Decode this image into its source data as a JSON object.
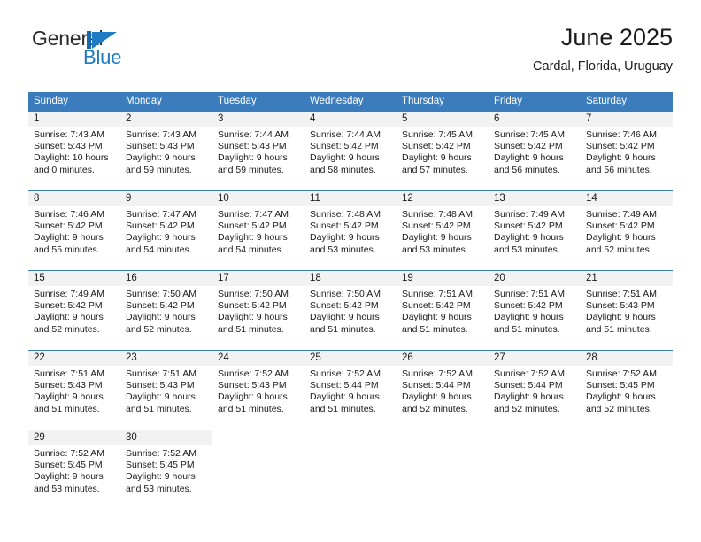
{
  "brand": {
    "name_top": "General",
    "name_bottom": "Blue",
    "mark": "blue-triangle-logo",
    "accent_color": "#1f7cc4"
  },
  "header": {
    "title": "June 2025",
    "subtitle": "Cardal, Florida, Uruguay"
  },
  "theme": {
    "header_blue": "#3b7cbd",
    "day_band_gray": "#f2f2f2",
    "text_color": "#1a1a1a"
  },
  "weekdays": [
    "Sunday",
    "Monday",
    "Tuesday",
    "Wednesday",
    "Thursday",
    "Friday",
    "Saturday"
  ],
  "weeks": [
    [
      {
        "day": "1",
        "sunrise": "Sunrise: 7:43 AM",
        "sunset": "Sunset: 5:43 PM",
        "daylight1": "Daylight: 10 hours",
        "daylight2": "and 0 minutes."
      },
      {
        "day": "2",
        "sunrise": "Sunrise: 7:43 AM",
        "sunset": "Sunset: 5:43 PM",
        "daylight1": "Daylight: 9 hours",
        "daylight2": "and 59 minutes."
      },
      {
        "day": "3",
        "sunrise": "Sunrise: 7:44 AM",
        "sunset": "Sunset: 5:43 PM",
        "daylight1": "Daylight: 9 hours",
        "daylight2": "and 59 minutes."
      },
      {
        "day": "4",
        "sunrise": "Sunrise: 7:44 AM",
        "sunset": "Sunset: 5:42 PM",
        "daylight1": "Daylight: 9 hours",
        "daylight2": "and 58 minutes."
      },
      {
        "day": "5",
        "sunrise": "Sunrise: 7:45 AM",
        "sunset": "Sunset: 5:42 PM",
        "daylight1": "Daylight: 9 hours",
        "daylight2": "and 57 minutes."
      },
      {
        "day": "6",
        "sunrise": "Sunrise: 7:45 AM",
        "sunset": "Sunset: 5:42 PM",
        "daylight1": "Daylight: 9 hours",
        "daylight2": "and 56 minutes."
      },
      {
        "day": "7",
        "sunrise": "Sunrise: 7:46 AM",
        "sunset": "Sunset: 5:42 PM",
        "daylight1": "Daylight: 9 hours",
        "daylight2": "and 56 minutes."
      }
    ],
    [
      {
        "day": "8",
        "sunrise": "Sunrise: 7:46 AM",
        "sunset": "Sunset: 5:42 PM",
        "daylight1": "Daylight: 9 hours",
        "daylight2": "and 55 minutes."
      },
      {
        "day": "9",
        "sunrise": "Sunrise: 7:47 AM",
        "sunset": "Sunset: 5:42 PM",
        "daylight1": "Daylight: 9 hours",
        "daylight2": "and 54 minutes."
      },
      {
        "day": "10",
        "sunrise": "Sunrise: 7:47 AM",
        "sunset": "Sunset: 5:42 PM",
        "daylight1": "Daylight: 9 hours",
        "daylight2": "and 54 minutes."
      },
      {
        "day": "11",
        "sunrise": "Sunrise: 7:48 AM",
        "sunset": "Sunset: 5:42 PM",
        "daylight1": "Daylight: 9 hours",
        "daylight2": "and 53 minutes."
      },
      {
        "day": "12",
        "sunrise": "Sunrise: 7:48 AM",
        "sunset": "Sunset: 5:42 PM",
        "daylight1": "Daylight: 9 hours",
        "daylight2": "and 53 minutes."
      },
      {
        "day": "13",
        "sunrise": "Sunrise: 7:49 AM",
        "sunset": "Sunset: 5:42 PM",
        "daylight1": "Daylight: 9 hours",
        "daylight2": "and 53 minutes."
      },
      {
        "day": "14",
        "sunrise": "Sunrise: 7:49 AM",
        "sunset": "Sunset: 5:42 PM",
        "daylight1": "Daylight: 9 hours",
        "daylight2": "and 52 minutes."
      }
    ],
    [
      {
        "day": "15",
        "sunrise": "Sunrise: 7:49 AM",
        "sunset": "Sunset: 5:42 PM",
        "daylight1": "Daylight: 9 hours",
        "daylight2": "and 52 minutes."
      },
      {
        "day": "16",
        "sunrise": "Sunrise: 7:50 AM",
        "sunset": "Sunset: 5:42 PM",
        "daylight1": "Daylight: 9 hours",
        "daylight2": "and 52 minutes."
      },
      {
        "day": "17",
        "sunrise": "Sunrise: 7:50 AM",
        "sunset": "Sunset: 5:42 PM",
        "daylight1": "Daylight: 9 hours",
        "daylight2": "and 51 minutes."
      },
      {
        "day": "18",
        "sunrise": "Sunrise: 7:50 AM",
        "sunset": "Sunset: 5:42 PM",
        "daylight1": "Daylight: 9 hours",
        "daylight2": "and 51 minutes."
      },
      {
        "day": "19",
        "sunrise": "Sunrise: 7:51 AM",
        "sunset": "Sunset: 5:42 PM",
        "daylight1": "Daylight: 9 hours",
        "daylight2": "and 51 minutes."
      },
      {
        "day": "20",
        "sunrise": "Sunrise: 7:51 AM",
        "sunset": "Sunset: 5:42 PM",
        "daylight1": "Daylight: 9 hours",
        "daylight2": "and 51 minutes."
      },
      {
        "day": "21",
        "sunrise": "Sunrise: 7:51 AM",
        "sunset": "Sunset: 5:43 PM",
        "daylight1": "Daylight: 9 hours",
        "daylight2": "and 51 minutes."
      }
    ],
    [
      {
        "day": "22",
        "sunrise": "Sunrise: 7:51 AM",
        "sunset": "Sunset: 5:43 PM",
        "daylight1": "Daylight: 9 hours",
        "daylight2": "and 51 minutes."
      },
      {
        "day": "23",
        "sunrise": "Sunrise: 7:51 AM",
        "sunset": "Sunset: 5:43 PM",
        "daylight1": "Daylight: 9 hours",
        "daylight2": "and 51 minutes."
      },
      {
        "day": "24",
        "sunrise": "Sunrise: 7:52 AM",
        "sunset": "Sunset: 5:43 PM",
        "daylight1": "Daylight: 9 hours",
        "daylight2": "and 51 minutes."
      },
      {
        "day": "25",
        "sunrise": "Sunrise: 7:52 AM",
        "sunset": "Sunset: 5:44 PM",
        "daylight1": "Daylight: 9 hours",
        "daylight2": "and 51 minutes."
      },
      {
        "day": "26",
        "sunrise": "Sunrise: 7:52 AM",
        "sunset": "Sunset: 5:44 PM",
        "daylight1": "Daylight: 9 hours",
        "daylight2": "and 52 minutes."
      },
      {
        "day": "27",
        "sunrise": "Sunrise: 7:52 AM",
        "sunset": "Sunset: 5:44 PM",
        "daylight1": "Daylight: 9 hours",
        "daylight2": "and 52 minutes."
      },
      {
        "day": "28",
        "sunrise": "Sunrise: 7:52 AM",
        "sunset": "Sunset: 5:45 PM",
        "daylight1": "Daylight: 9 hours",
        "daylight2": "and 52 minutes."
      }
    ],
    [
      {
        "day": "29",
        "sunrise": "Sunrise: 7:52 AM",
        "sunset": "Sunset: 5:45 PM",
        "daylight1": "Daylight: 9 hours",
        "daylight2": "and 53 minutes."
      },
      {
        "day": "30",
        "sunrise": "Sunrise: 7:52 AM",
        "sunset": "Sunset: 5:45 PM",
        "daylight1": "Daylight: 9 hours",
        "daylight2": "and 53 minutes."
      },
      {
        "day": "",
        "sunrise": "",
        "sunset": "",
        "daylight1": "",
        "daylight2": ""
      },
      {
        "day": "",
        "sunrise": "",
        "sunset": "",
        "daylight1": "",
        "daylight2": ""
      },
      {
        "day": "",
        "sunrise": "",
        "sunset": "",
        "daylight1": "",
        "daylight2": ""
      },
      {
        "day": "",
        "sunrise": "",
        "sunset": "",
        "daylight1": "",
        "daylight2": ""
      },
      {
        "day": "",
        "sunrise": "",
        "sunset": "",
        "daylight1": "",
        "daylight2": ""
      }
    ]
  ]
}
